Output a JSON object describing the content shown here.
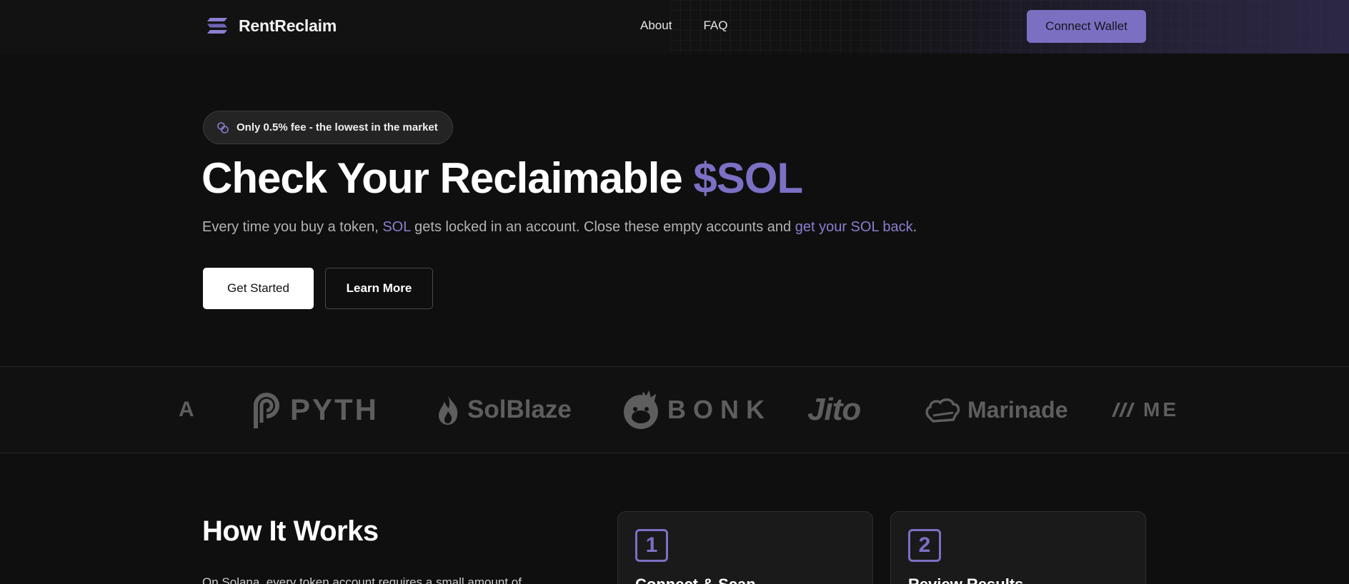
{
  "header": {
    "brand": "RentReclaim",
    "nav": [
      "About",
      "FAQ"
    ],
    "connect_label": "Connect Wallet"
  },
  "hero": {
    "badge": "Only 0.5% fee - the lowest in the market",
    "title_main": "Check Your Reclaimable ",
    "title_accent": "$SOL",
    "sub_1": "Every time you buy a token, ",
    "sub_2": "SOL",
    "sub_3": " gets locked in an account. Close these empty accounts and ",
    "sub_4": "get your SOL back",
    "sub_5": ".",
    "primary_label": "Get Started",
    "secondary_label": "Learn More"
  },
  "partners": {
    "partial_left": "A",
    "pyth": "PYTH",
    "solblaze": "SolBlaze",
    "bonk": "BONK",
    "jito": "Jito",
    "marinade": "Marinade",
    "partial_right": "ME"
  },
  "how": {
    "title": "How It Works",
    "text": "On Solana, every token account requires a small amount of",
    "cards": [
      {
        "num": "1",
        "title": "Connect & Scan"
      },
      {
        "num": "2",
        "title": "Review Results"
      }
    ]
  },
  "colors": {
    "accent": "#7b70c4",
    "background": "#0f0f0f"
  }
}
